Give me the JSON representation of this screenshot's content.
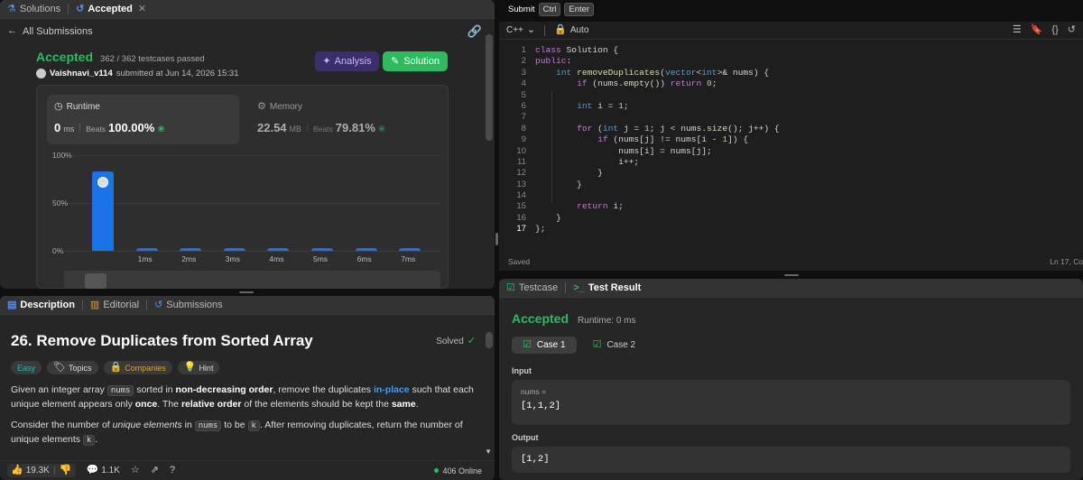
{
  "top_left": {
    "tab_solutions": "Solutions",
    "tab_accepted": "Accepted",
    "back_label": "All Submissions",
    "status": "Accepted",
    "testcases": "362 / 362 testcases passed",
    "user": "Vaishnavi_v114",
    "submitted_at": "submitted at Jun 14, 2026 15:31",
    "analysis_btn": "Analysis",
    "solution_btn": "Solution",
    "runtime_title": "Runtime",
    "runtime_value": "0",
    "runtime_unit": "ms",
    "runtime_beats_label": "Beats",
    "runtime_beats": "100.00%",
    "memory_title": "Memory",
    "memory_value": "22.54",
    "memory_unit": "MB",
    "memory_beats_label": "Beats",
    "memory_beats": "79.81%"
  },
  "chart_data": {
    "type": "bar",
    "categories": [
      "0ms",
      "1ms",
      "2ms",
      "3ms",
      "4ms",
      "5ms",
      "6ms",
      "7ms"
    ],
    "x_tick_labels": [
      "",
      "1ms",
      "2ms",
      "3ms",
      "4ms",
      "5ms",
      "6ms",
      "7ms"
    ],
    "values": [
      83,
      1,
      1,
      1,
      1,
      1,
      1,
      1
    ],
    "y_ticks": [
      "100%",
      "50%",
      "0%"
    ],
    "ylim": [
      0,
      100
    ]
  },
  "editor": {
    "submit": "Submit",
    "key1": "Ctrl",
    "key2": "Enter",
    "language": "C++",
    "mode": "Auto",
    "saved": "Saved",
    "cursor": "Ln 17, Col",
    "lines": [
      "class Solution {",
      "public:",
      "    int removeDuplicates(vector<int>& nums) {",
      "        if (nums.empty()) return 0;",
      "",
      "        int i = 1;",
      "",
      "        for (int j = 1; j < nums.size(); j++) {",
      "            if (nums[j] != nums[i - 1]) {",
      "                nums[i] = nums[j];",
      "                i++;",
      "            }",
      "        }",
      "",
      "        return i;",
      "    }",
      "};"
    ]
  },
  "description": {
    "tab_description": "Description",
    "tab_editorial": "Editorial",
    "tab_submissions": "Submissions",
    "title": "26. Remove Duplicates from Sorted Array",
    "solved": "Solved",
    "tag_easy": "Easy",
    "tag_topics": "Topics",
    "tag_companies": "Companies",
    "tag_hint": "Hint",
    "p1_a": "Given an integer array ",
    "p1_code": "nums",
    "p1_b": " sorted in ",
    "p1_bold1": "non-decreasing order",
    "p1_c": ", remove the duplicates ",
    "p1_link": "in-place",
    "p1_d": " such that each unique element appears only ",
    "p1_bold2": "once",
    "p1_e": ". The ",
    "p1_bold3": "relative order",
    "p1_f": " of the elements should be kept the ",
    "p1_bold4": "same",
    "p1_g": ".",
    "p2_a": "Consider the number of ",
    "p2_it": "unique elements",
    "p2_b": " in ",
    "p2_code": "nums",
    "p2_c": " to be ",
    "p2_code2": "k",
    "p2_d": ". After removing duplicates, return the number of unique elements ",
    "p2_code3": "k",
    "p2_e": ".",
    "likes": "19.3K",
    "comments": "1.1K",
    "online": "406 Online"
  },
  "result": {
    "tab_testcase": "Testcase",
    "tab_result": "Test Result",
    "status": "Accepted",
    "runtime": "Runtime: 0 ms",
    "case1": "Case 1",
    "case2": "Case 2",
    "input_label": "Input",
    "var_label": "nums =",
    "input_value": "[1,1,2]",
    "output_label": "Output",
    "output_value": "[1,2]"
  },
  "colors": {
    "accent_green": "#2cbb5d",
    "bar_blue": "#1a73e8",
    "analysis_purple": "#4b3a8a",
    "link_blue": "#3b9dff"
  }
}
